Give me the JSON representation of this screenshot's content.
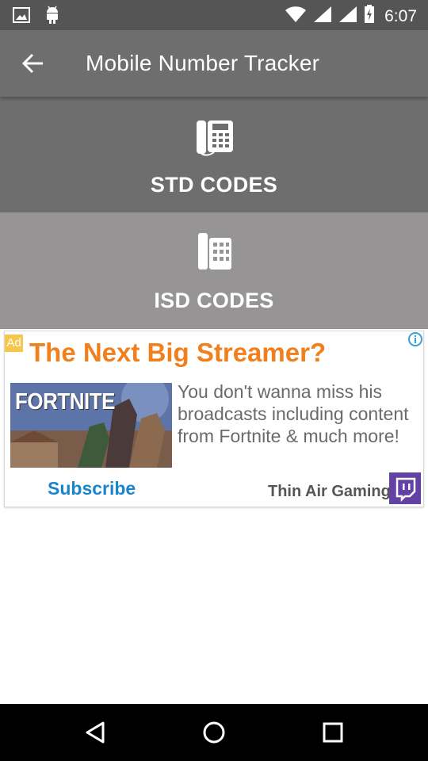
{
  "status_bar": {
    "time": "6:07",
    "icons": [
      "image-icon",
      "android-icon",
      "wifi-icon",
      "signal-icon",
      "signal-icon",
      "battery-charging-icon"
    ]
  },
  "app_bar": {
    "title": "Mobile Number Tracker",
    "back_icon": "arrow-left-icon"
  },
  "menu": [
    {
      "label": "STD CODES",
      "icon": "desk-phone-icon"
    },
    {
      "label": "ISD CODES",
      "icon": "desk-phone-icon"
    }
  ],
  "ad": {
    "badge": "Ad",
    "headline": "The Next Big Streamer?",
    "image_text": "FORTNITE",
    "body": "You don't wanna miss his broadcasts including content from Fortnite & much more!",
    "cta": "Subscribe",
    "advertiser": "Thin Air Gaming",
    "brand_icon": "twitch-icon",
    "info_icon": "info-icon"
  },
  "nav_bar": {
    "buttons": [
      "back-triangle-icon",
      "home-circle-icon",
      "recents-square-icon"
    ]
  },
  "colors": {
    "status_bar": "#555555",
    "app_bar": "#6f6e6f",
    "tile_std": "#6f6e6f",
    "tile_isd": "#979495",
    "ad_headline": "#f07f1c",
    "ad_cta": "#1a85cf",
    "twitch": "#6441a4"
  }
}
